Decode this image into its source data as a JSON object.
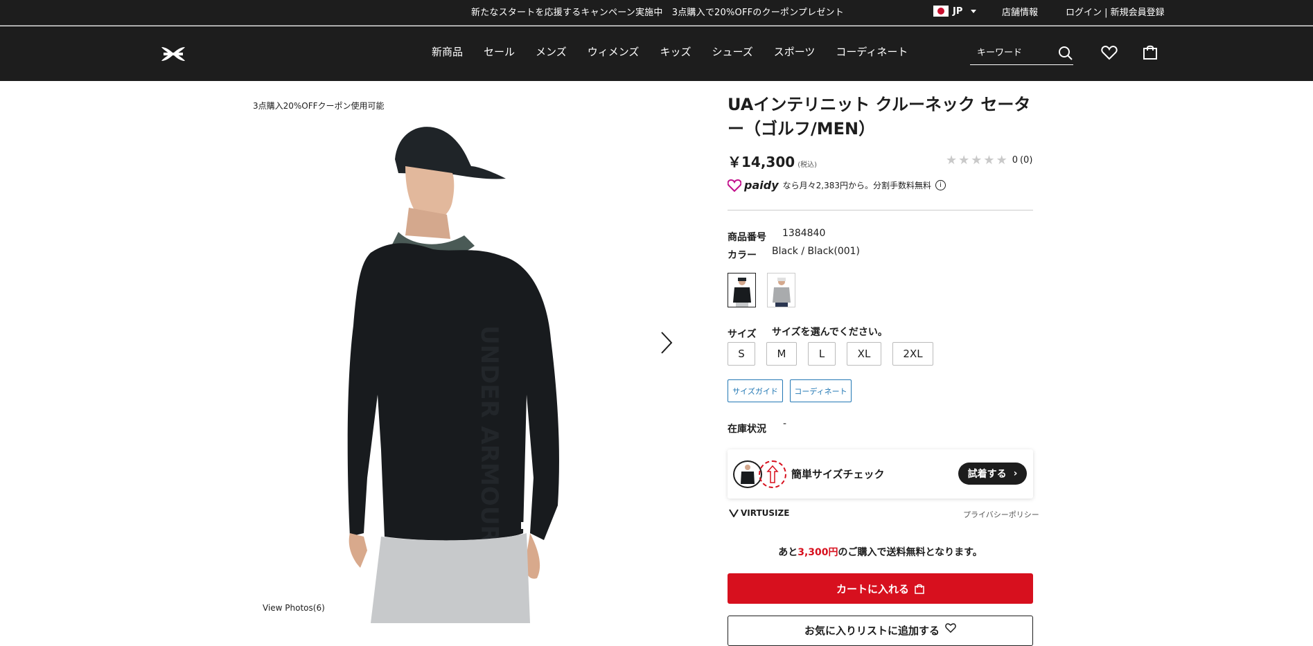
{
  "topbar": {
    "promo": "新たなスタートを応援するキャンペーン実施中　3点購入で20%OFFのクーポンプレゼント",
    "country": "JP",
    "store_info": "店舗情報",
    "login": "ログイン | 新規会員登録"
  },
  "header": {
    "logo": "Under Armour logo",
    "nav": [
      "新商品",
      "セール",
      "メンズ",
      "ウィメンズ",
      "キッズ",
      "シューズ",
      "スポーツ",
      "コーディネート"
    ],
    "search_placeholder": "キーワード"
  },
  "gallery": {
    "coupon_tag": "3点購入20%OFFクーポン使用可能",
    "view_photos": "View Photos(6)"
  },
  "product": {
    "title": "UAインテリニット クルーネック セーター（ゴルフ/MEN）",
    "price": "￥14,300",
    "tax_note": "(税込)",
    "rating": 0,
    "rating_score": "0",
    "review_count": "(0)",
    "paidy_brand": "paidy",
    "paidy_text": "なら月々2,383円から。分割手数料無料",
    "sku_label": "商品番号",
    "sku": "1384840",
    "color_label": "カラー",
    "color_value": "Black / Black(001)",
    "size_label": "サイズ",
    "size_prompt": "サイズを選んでください。",
    "sizes": [
      "S",
      "M",
      "L",
      "XL",
      "2XL"
    ],
    "size_guide": "サイズガイド",
    "coordinate": "コーディネート",
    "stock_label": "在庫状況",
    "stock_value": "-"
  },
  "virtusize": {
    "check_text": "簡単サイズチェック",
    "try_button": "試着する",
    "brand": "VIRTUSIZE",
    "privacy": "プライバシーポリシー"
  },
  "shipping": {
    "prefix": "あと",
    "amount": "3,300円",
    "suffix": "のご購入で送料無料となります。"
  },
  "actions": {
    "add_to_cart": "カートに入れる",
    "add_to_favorites": "お気に入りリストに追加する"
  }
}
